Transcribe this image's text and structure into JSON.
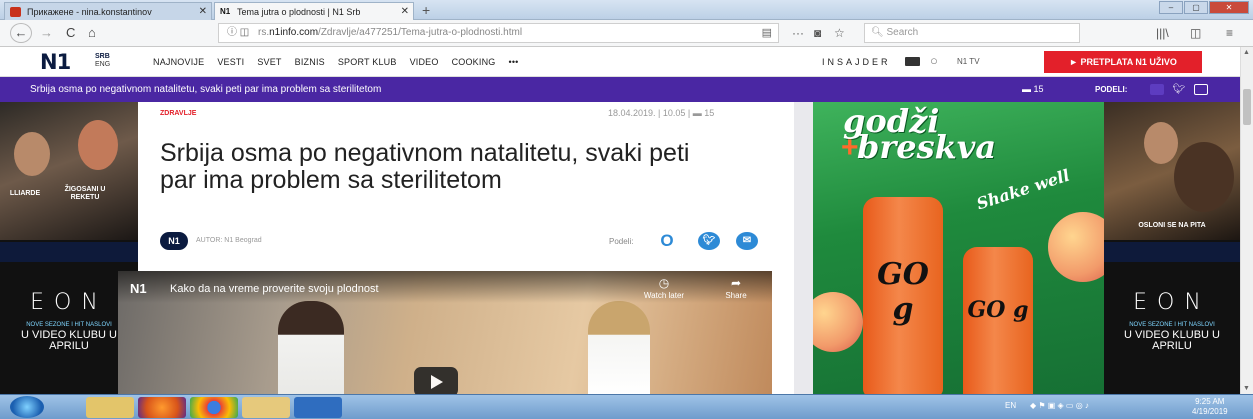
{
  "browser": {
    "tabs": [
      {
        "title": "Прикажене - nina.konstantinov",
        "close": "✕"
      },
      {
        "title": "Tema jutra o plodnosti | N1 Srb",
        "close": "✕"
      }
    ],
    "new_tab": "+",
    "nav": {
      "back": "←",
      "forward": "→",
      "reload": "C",
      "home": "⌂"
    },
    "url_prefix": "rs.",
    "url_domain": "n1info.com",
    "url_path": "/Zdravlje/a477251/Tema-jutra-o-plodnosti.html",
    "page_actions": "···",
    "search_placeholder": "Search",
    "toolbar_right": {
      "library": "|||\\",
      "sidebar": "◫",
      "menu": "≡"
    }
  },
  "site": {
    "logo": "N1",
    "lang_primary": "SRB",
    "lang_secondary": "ENG",
    "nav": [
      "NAJNOVIJE",
      "VESTI",
      "SVET",
      "BIZNIS",
      "SPORT KLUB",
      "VIDEO",
      "COOKING",
      "•••"
    ],
    "insajder": "INSAJDER",
    "n1tv": "N1 TV",
    "live_button": "► PRETPLATA N1 UŽIVO",
    "sticky_title": "Srbija osma po negativnom natalitetu, svaki peti par ima problem sa sterilitetom",
    "comment_count": "15",
    "podeli": "PODELI:"
  },
  "article": {
    "category": "ZDRAVLJE",
    "date": "18.04.2019.",
    "time": "10.05",
    "comments": "15",
    "headline": "Srbija osma po negativnom natalitetu, svaki peti par ima problem sa sterilitetom",
    "author_badge": "N1",
    "author": "AUTOR: N1 Beograd",
    "share_label": "Podeli:"
  },
  "video": {
    "logo": "N1",
    "title": "Kako da na vreme proverite svoju plodnost",
    "watch_later": "Watch later",
    "share": "Share"
  },
  "ads": {
    "left_caption_1": "LLIARDE",
    "left_caption_2": "ŽIGOSANI U REKETU",
    "right_caption": "OSLONI SE NA PITA",
    "eon": "EON",
    "eon_small": "NOVE SEZONE I HIT NASLOVI",
    "eon_big": "U VIDEO KLUBU U APRILU",
    "mid_line1": "godži",
    "mid_line2": "breskva",
    "mid_shake": "Shake well",
    "mid_bottle_text": "GO g"
  },
  "taskbar": {
    "tray_lang": "EN",
    "time": "9:25 AM",
    "date": "4/19/2019"
  },
  "colors": {
    "n1_red": "#e3202a",
    "n1_purple": "#4a27a3",
    "n1_navy": "#0b1b40",
    "twitter": "#2d8ad6",
    "ad_green": "#1f8a3d"
  }
}
